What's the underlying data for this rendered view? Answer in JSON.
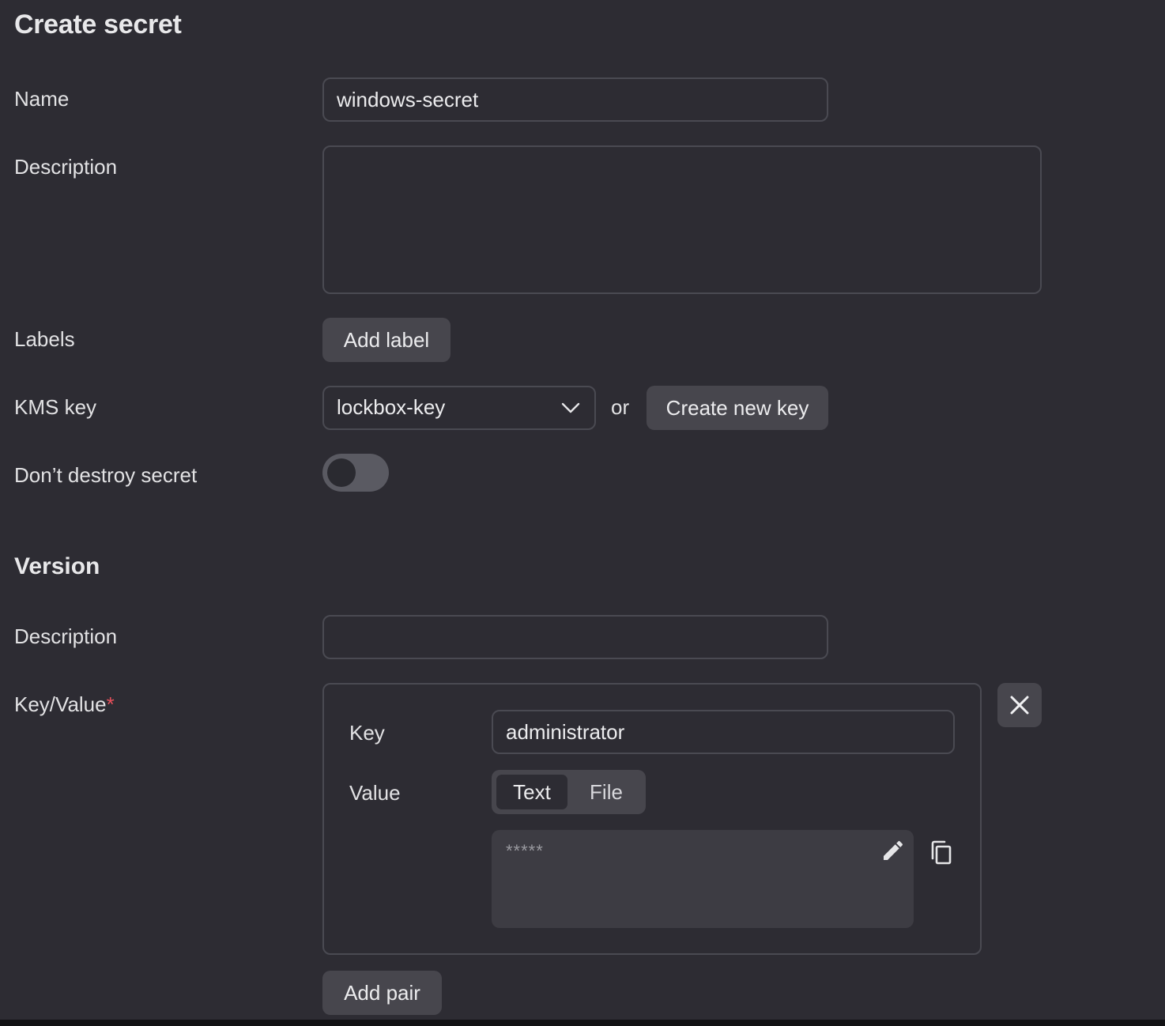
{
  "page": {
    "title": "Create secret"
  },
  "form": {
    "name_label": "Name",
    "name_value": "windows-secret",
    "description_label": "Description",
    "description_value": "",
    "labels_label": "Labels",
    "add_label_button": "Add label",
    "kms_label": "KMS key",
    "kms_selected": "lockbox-key",
    "or_text": "or",
    "create_key_button": "Create new key",
    "dont_destroy_label": "Don’t destroy secret",
    "dont_destroy_enabled": false
  },
  "version": {
    "title": "Version",
    "description_label": "Description",
    "description_value": "",
    "kv_label": "Key/Value",
    "kv_required_mark": "*",
    "pair": {
      "key_label": "Key",
      "key_value": "administrator",
      "value_label": "Value",
      "value_tabs": [
        "Text",
        "File"
      ],
      "active_tab": "Text",
      "masked_value": "*****"
    },
    "add_pair_button": "Add pair"
  },
  "icons": {
    "kms_dropdown": "chevron-down-icon",
    "remove_pair": "close-icon",
    "edit_value": "pencil-icon",
    "copy_value": "copy-icon"
  },
  "colors": {
    "background": "#2d2c33",
    "button": "#47464d",
    "border": "#4a4a52",
    "required": "#e8505b"
  }
}
